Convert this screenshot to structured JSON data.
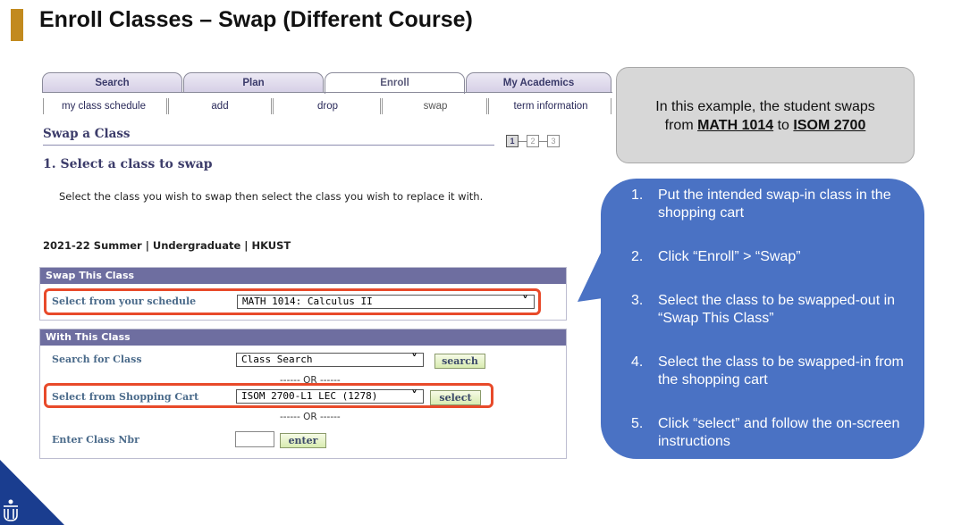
{
  "slide": {
    "title": "Enroll Classes – Swap (Different Course)"
  },
  "tabs": [
    {
      "label": "Search"
    },
    {
      "label": "Plan"
    },
    {
      "label": "Enroll"
    },
    {
      "label": "My Academics"
    }
  ],
  "subtabs": [
    {
      "label": "my class schedule"
    },
    {
      "label": "add"
    },
    {
      "label": "drop"
    },
    {
      "label": "swap"
    },
    {
      "label": "term information"
    }
  ],
  "page": {
    "heading": "Swap a Class",
    "steps": [
      "1",
      "2",
      "3"
    ],
    "current_step": 1,
    "section_heading": "1.  Select a class to swap",
    "instruction": "Select the class you wish to swap then select the class you wish to replace it with.",
    "term": "2021-22 Summer | Undergraduate | HKUST"
  },
  "swap_this_class": {
    "header": "Swap This Class",
    "label": "Select from your schedule",
    "value": "MATH 1014: Calculus II"
  },
  "with_this_class": {
    "header": "With This Class",
    "search_label": "Search for Class",
    "search_value": "Class Search",
    "search_button": "search",
    "or1": "------ OR ------",
    "cart_label": "Select from Shopping Cart",
    "cart_value": "ISOM 2700-L1 LEC (1278)",
    "select_button": "select",
    "or2": "------ OR ------",
    "nbr_label": "Enter Class Nbr",
    "nbr_value": "",
    "enter_button": "enter"
  },
  "example_callout": {
    "line1": "In this example, the student swaps",
    "from_word": "from",
    "from_course": "MATH 1014",
    "to_word": "to",
    "to_course": "ISOM 2700"
  },
  "instructions": [
    {
      "num": "1.",
      "text": "Put the intended swap-in class in the shopping cart"
    },
    {
      "num": "2.",
      "text": "Click “Enroll” > “Swap”"
    },
    {
      "num": "3.",
      "text": "Select the class to be swapped-out in “Swap This Class”"
    },
    {
      "num": "4.",
      "text": "Select the class to be swapped-in from the shopping cart"
    },
    {
      "num": "5.",
      "text": "Click “select” and follow the on-screen instructions"
    }
  ],
  "colors": {
    "accent_bar": "#c28a1e",
    "callout_blue": "#4a72c4",
    "highlight_red": "#e84a2a",
    "group_header": "#6e6ea0"
  }
}
